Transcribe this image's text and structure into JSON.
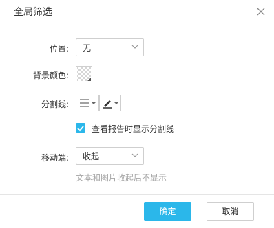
{
  "dialog": {
    "title": "全局筛选",
    "close_icon": "close-icon"
  },
  "position": {
    "label": "位置:",
    "value": "无"
  },
  "background": {
    "label": "背景颜色:",
    "icon": "transparent-color-swatch-icon"
  },
  "divider": {
    "label": "分割线:",
    "style_icon": "line-style-icon",
    "color_icon": "pen-color-icon"
  },
  "report_divider": {
    "label": "查看报告时显示分割线",
    "checked": true
  },
  "mobile": {
    "label": "移动端:",
    "value": "收起",
    "hint": "文本和图片收起后不显示"
  },
  "footer": {
    "ok_label": "确定",
    "cancel_label": "取消"
  },
  "colors": {
    "accent": "#2bb7ea",
    "border": "#cfcfcf",
    "hint": "#a6a6a6"
  }
}
